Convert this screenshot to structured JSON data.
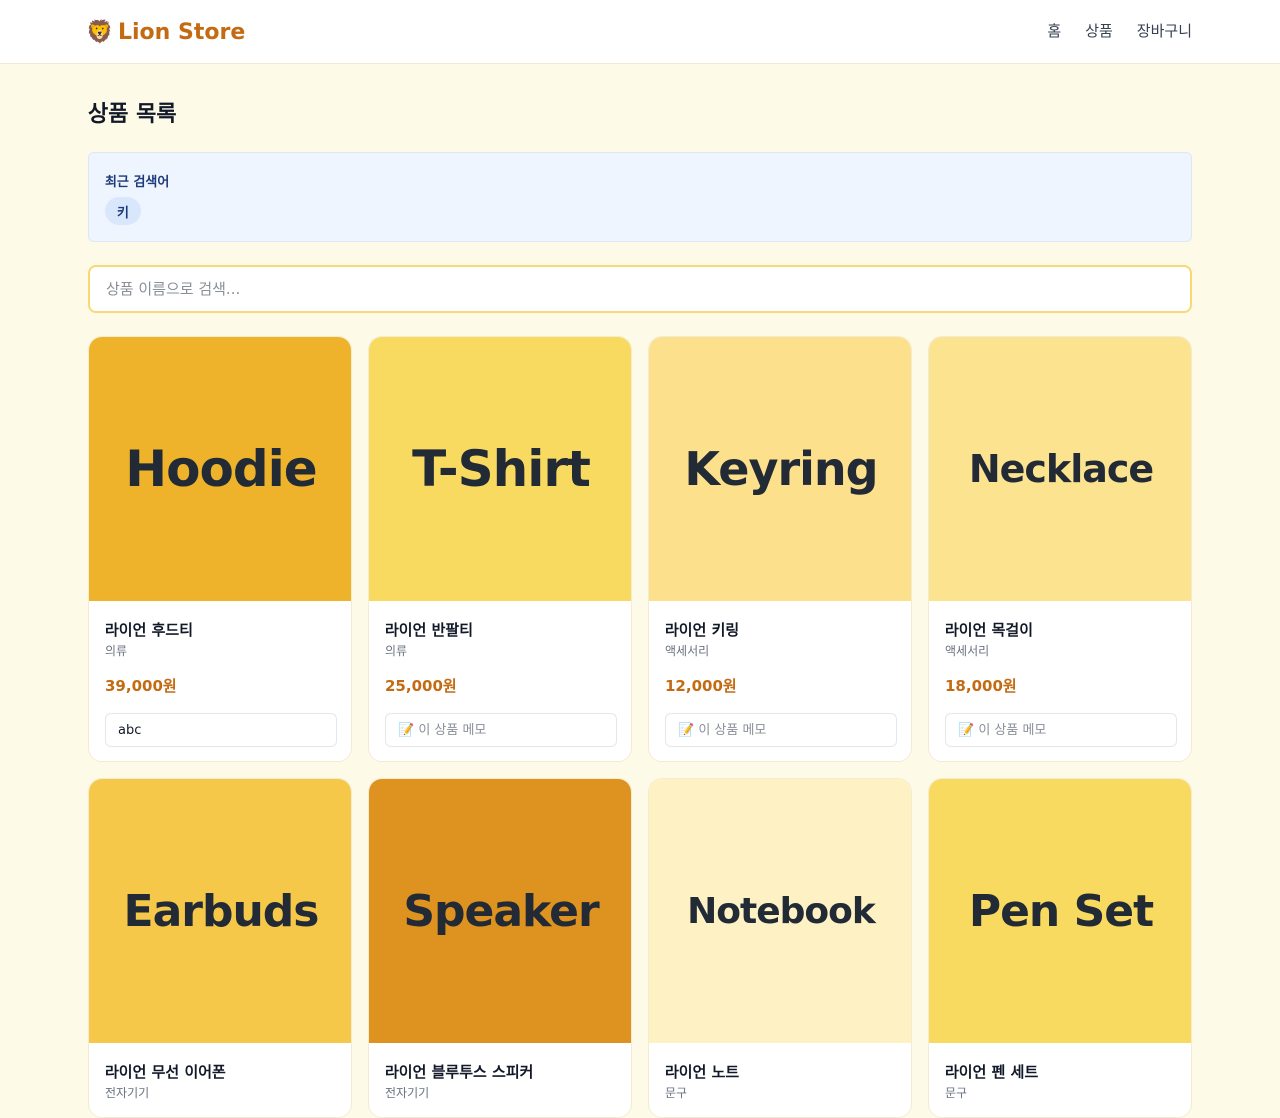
{
  "header": {
    "brand_icon": "lion-emoji-icon",
    "brand_emoji": "🦁",
    "brand_name": "Lion Store",
    "nav": [
      "홈",
      "상품",
      "장바구니"
    ]
  },
  "page": {
    "title": "상품 목록"
  },
  "recent_searches": {
    "label": "최근 검색어",
    "items": [
      "키"
    ]
  },
  "search": {
    "placeholder": "상품 이름으로 검색...",
    "value": ""
  },
  "colors": {
    "accent": "#c46a12",
    "page_bg": "#fefae8"
  },
  "products": [
    {
      "image_text": "Hoodie",
      "image_color": "#eeb32a",
      "name": "라이언 후드티",
      "category": "의류",
      "price": "39,000원",
      "memo_placeholder": "📝 이 상품 메모",
      "memo_value": "abc"
    },
    {
      "image_text": "T-Shirt",
      "image_color": "#f9da60",
      "name": "라이언 반팔티",
      "category": "의류",
      "price": "25,000원",
      "memo_placeholder": "📝 이 상품 메모",
      "memo_value": ""
    },
    {
      "image_text": "Keyring",
      "image_color": "#fde08c",
      "name": "라이언 키링",
      "category": "액세서리",
      "price": "12,000원",
      "memo_placeholder": "📝 이 상품 메모",
      "memo_value": ""
    },
    {
      "image_text": "Necklace",
      "image_color": "#fbe390",
      "name": "라이언 목걸이",
      "category": "액세서리",
      "price": "18,000원",
      "memo_placeholder": "📝 이 상품 메모",
      "memo_value": ""
    },
    {
      "image_text": "Earbuds",
      "image_color": "#f5c84a",
      "name": "라이언 무선 이어폰",
      "category": "전자기기"
    },
    {
      "image_text": "Speaker",
      "image_color": "#de921f",
      "name": "라이언 블루투스 스피커",
      "category": "전자기기"
    },
    {
      "image_text": "Notebook",
      "image_color": "#fef2c4",
      "name": "라이언 노트",
      "category": "문구"
    },
    {
      "image_text": "Pen Set",
      "image_color": "#f9da60",
      "name": "라이언 펜 세트",
      "category": "문구"
    }
  ]
}
